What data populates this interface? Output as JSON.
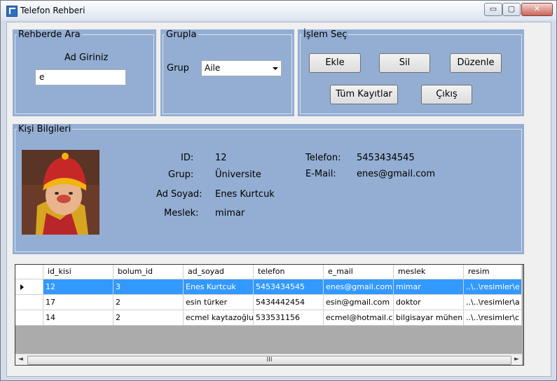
{
  "window": {
    "title": "Telefon  Rehberi",
    "controls": {
      "minimize": "▭",
      "maximize": "▢",
      "close": "✕"
    }
  },
  "search": {
    "legend": "Rehberde Ara",
    "prompt": "Ad Giriniz",
    "value": "e"
  },
  "group_filter": {
    "legend": "Grupla",
    "label": "Grup",
    "selected": "Aile"
  },
  "actions": {
    "legend": "İşlem Seç",
    "add": "Ekle",
    "delete": "Sil",
    "edit": "Düzenle",
    "all_records": "Tüm Kayıtlar",
    "exit": "Çıkış"
  },
  "details": {
    "legend": "Kişi Bilgileri",
    "labels": {
      "id": "ID:",
      "group": "Grup:",
      "name": "Ad Soyad:",
      "job": "Meslek:",
      "phone": "Telefon:",
      "email": "E-Mail:"
    },
    "values": {
      "id": "12",
      "group": "Üniversite",
      "name": "Enes Kurtcuk",
      "job": "mimar",
      "phone": "5453434545",
      "email": "enes@gmail.com"
    }
  },
  "grid": {
    "columns": [
      "id_kisi",
      "bolum_id",
      "ad_soyad",
      "telefon",
      "e_mail",
      "meslek",
      "resim"
    ],
    "rows": [
      [
        "12",
        "3",
        "Enes Kurtcuk",
        "5453434545",
        "enes@gmail.com",
        "mimar",
        "..\\..\\resimler\\e"
      ],
      [
        "17",
        "2",
        "esin türker",
        "5434442454",
        "esin@gmail.com",
        "doktor",
        "..\\..\\resimler\\a"
      ],
      [
        "14",
        "2",
        "ecmel kaytazoğlu",
        "533531156",
        "ecmel@hotmail.c...",
        "bilgisayar mühen...",
        "..\\..\\resimler\\c"
      ]
    ],
    "scrollbar": {
      "left": "◄",
      "right": "►",
      "grip": "III"
    }
  },
  "colors": {
    "group_bg": "#93aed2",
    "selection": "#3399ff"
  }
}
